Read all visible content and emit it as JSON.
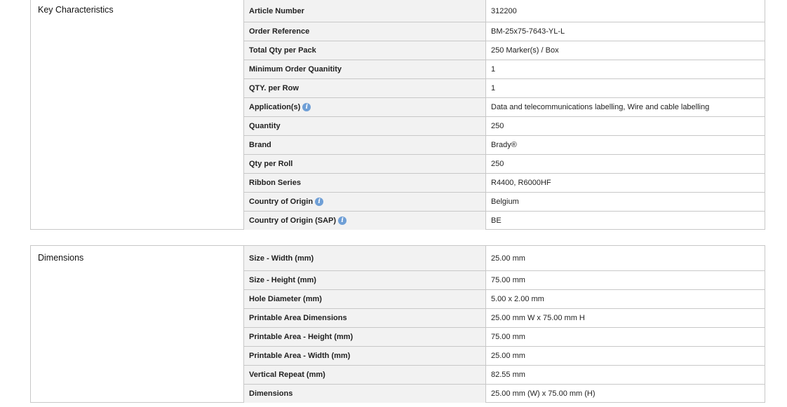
{
  "key_characteristics": {
    "title": "Key Characteristics",
    "rows": [
      {
        "label": "Article Number",
        "value": "312200"
      },
      {
        "label": "Order Reference",
        "value": "BM-25x75-7643-YL-L"
      },
      {
        "label": "Total Qty per Pack",
        "value": "250 Marker(s) / Box"
      },
      {
        "label": "Minimum Order Quanitity",
        "value": "1"
      },
      {
        "label": "QTY. per Row",
        "value": "1"
      },
      {
        "label": "Application(s)",
        "value": "Data and telecommunications labelling, Wire and cable labelling"
      },
      {
        "label": "Quantity",
        "value": "250"
      },
      {
        "label": "Brand",
        "value": "Brady®"
      },
      {
        "label": "Qty per Roll",
        "value": "250"
      },
      {
        "label": "Ribbon Series",
        "value": "R4400, R6000HF"
      },
      {
        "label": "Country of Origin",
        "value": "Belgium"
      },
      {
        "label": "Country of Origin (SAP)",
        "value": "BE"
      }
    ]
  },
  "dimensions": {
    "title": "Dimensions",
    "rows": [
      {
        "label": "Size - Width (mm)",
        "value": "25.00 mm"
      },
      {
        "label": "Size - Height (mm)",
        "value": "75.00 mm"
      },
      {
        "label": "Hole Diameter (mm)",
        "value": "5.00 x 2.00 mm"
      },
      {
        "label": "Printable Area Dimensions",
        "value": "25.00 mm W x 75.00 mm H"
      },
      {
        "label": "Printable Area - Height (mm)",
        "value": "75.00 mm"
      },
      {
        "label": "Printable Area - Width (mm)",
        "value": "25.00 mm"
      },
      {
        "label": "Vertical Repeat (mm)",
        "value": "82.55 mm"
      },
      {
        "label": "Dimensions",
        "value": "25.00 mm (W) x 75.00 mm (H)"
      }
    ]
  },
  "icons": {
    "info_glyph": "i",
    "info_color": "#6f9fd6"
  }
}
